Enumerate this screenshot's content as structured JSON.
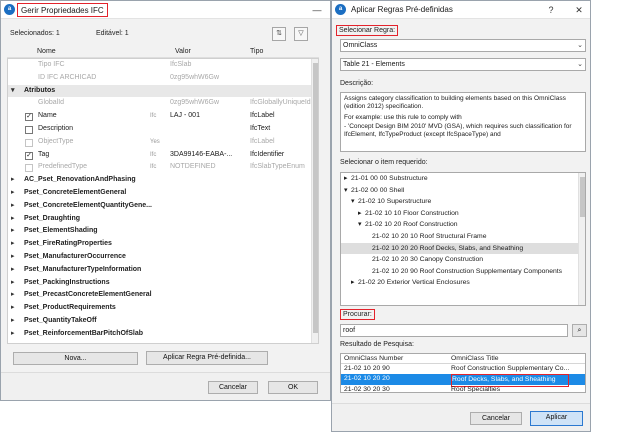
{
  "left": {
    "title": "Gerir Propriedades IFC",
    "min_btn": "—",
    "selected_label": "Selecionados: 1",
    "editable_label": "Editável: 1",
    "tool_icons": [
      "assign-icon",
      "filter-icon"
    ],
    "columns": {
      "name": "Nome",
      "value": "Valor",
      "type": "Tipo"
    },
    "rows": [
      {
        "kind": "dim",
        "indent": 1,
        "name": "Tipo IFC",
        "value": "IfcSlab",
        "type": ""
      },
      {
        "kind": "dim",
        "indent": 1,
        "name": "ID IFC ARCHICAD",
        "value": "0zg95whW6Gw",
        "type": ""
      },
      {
        "kind": "grp",
        "indent": 0,
        "toggle": "▾",
        "name": "Atributos",
        "value": "",
        "type": ""
      },
      {
        "kind": "dim",
        "indent": 1,
        "name": "GlobalId",
        "value": "0zg95whW6Gw",
        "type": "IfcGloballyUniqueId"
      },
      {
        "kind": "cb",
        "checked": "✓",
        "indent": 1,
        "name": "Name",
        "value": "LAJ - 001",
        "type": "IfcLabel",
        "prefix": "Ifc"
      },
      {
        "kind": "cb",
        "checked": "",
        "indent": 1,
        "name": "Description",
        "value": "",
        "type": "IfcText"
      },
      {
        "kind": "dim",
        "cb": true,
        "indent": 1,
        "name": "ObjectType",
        "value": "",
        "type": "IfcLabel",
        "prefix": "Yes"
      },
      {
        "kind": "cb",
        "checked": "✓",
        "indent": 1,
        "name": "Tag",
        "value": "3DA99146-EABA-...",
        "type": "IfcIdentifier",
        "prefix": "Ifc"
      },
      {
        "kind": "dim",
        "cb": true,
        "indent": 1,
        "name": "PredefinedType",
        "value": "NOTDEFINED",
        "type": "IfcSlabTypeEnum",
        "prefix": "Ifc"
      },
      {
        "kind": "pset",
        "toggle": "▸",
        "name": "AC_Pset_RenovationAndPhasing"
      },
      {
        "kind": "pset",
        "toggle": "▸",
        "name": "Pset_ConcreteElementGeneral"
      },
      {
        "kind": "pset",
        "toggle": "▸",
        "name": "Pset_ConcreteElementQuantityGene..."
      },
      {
        "kind": "pset",
        "toggle": "▸",
        "name": "Pset_Draughting"
      },
      {
        "kind": "pset",
        "toggle": "▸",
        "name": "Pset_ElementShading"
      },
      {
        "kind": "pset",
        "toggle": "▸",
        "name": "Pset_FireRatingProperties"
      },
      {
        "kind": "pset",
        "toggle": "▸",
        "name": "Pset_ManufacturerOccurrence"
      },
      {
        "kind": "pset",
        "toggle": "▸",
        "name": "Pset_ManufacturerTypeInformation"
      },
      {
        "kind": "pset",
        "toggle": "▸",
        "name": "Pset_PackingInstructions"
      },
      {
        "kind": "pset",
        "toggle": "▸",
        "name": "Pset_PrecastConcreteElementGeneral"
      },
      {
        "kind": "pset",
        "toggle": "▸",
        "name": "Pset_ProductRequirements"
      },
      {
        "kind": "pset",
        "toggle": "▸",
        "name": "Pset_QuantityTakeOff"
      },
      {
        "kind": "pset",
        "toggle": "▸",
        "name": "Pset_ReinforcementBarPitchOfSlab"
      }
    ],
    "new_btn": "Nova...",
    "apply_rule_btn": "Aplicar Regra Pré-definida...",
    "cancel_btn": "Cancelar",
    "ok_btn": "OK"
  },
  "right": {
    "title": "Aplicar Regras Pré-definidas",
    "help_btn": "?",
    "close_btn": "✕",
    "select_rule_label": "Selecionar Regra:",
    "rule_value": "OmniClass",
    "table_value": "Table 21 - Elements",
    "description_label": "Descrição:",
    "description_paragraphs": [
      "Assigns category classification to building elements based on this OmniClass (edition 2012) specification.",
      "For example: use this rule to comply with\n- 'Concept Design BIM 2010' MVD (GSA), which requires such classification for IfcElement, IfcTypeProduct (except IfcSpaceType) and"
    ],
    "select_item_label": "Selecionar o item requerido:",
    "tree": [
      {
        "indent": 0,
        "toggle": "▸",
        "text": "21-01 00 00 Substructure"
      },
      {
        "indent": 0,
        "toggle": "▾",
        "text": "21-02 00 00 Shell"
      },
      {
        "indent": 1,
        "toggle": "▾",
        "text": "21-02 10 Superstructure"
      },
      {
        "indent": 2,
        "toggle": "▸",
        "text": "21-02 10 10 Floor Construction"
      },
      {
        "indent": 2,
        "toggle": "▾",
        "text": "21-02 10 20 Roof Construction"
      },
      {
        "indent": 3,
        "toggle": "",
        "text": "21-02 10 20 10 Roof Structural Frame"
      },
      {
        "indent": 3,
        "toggle": "",
        "text": "21-02 10 20 20 Roof Decks, Slabs, and Sheathing",
        "selected": true
      },
      {
        "indent": 3,
        "toggle": "",
        "text": "21-02 10 20 30 Canopy Construction"
      },
      {
        "indent": 3,
        "toggle": "",
        "text": "21-02 10 20 90 Roof Construction Supplementary Components"
      },
      {
        "indent": 1,
        "toggle": "▸",
        "text": "21-02 20 Exterior Vertical Enclosures"
      }
    ],
    "search_label": "Procurar:",
    "search_value": "roof",
    "results_label": "Resultado de Pesquisa:",
    "results_header": {
      "number": "OmniClass Number",
      "title": "OmniClass Title"
    },
    "results": [
      {
        "number": "21-02 10 20 90",
        "title": "Roof Construction Supplementary Co..."
      },
      {
        "number": "21-02 10 20 20",
        "title": "Roof Decks, Slabs, and Sheathing",
        "selected": true
      },
      {
        "number": "21-02 30 20 30",
        "title": "Roof Specialties"
      },
      {
        "number": "21-02 10 20 10",
        "title": "Roof Structural Frame"
      },
      {
        "number": "21-02 10 20 30",
        "title": "Canopy Construction"
      }
    ],
    "cancel_btn": "Cancelar",
    "apply_btn": "Aplicar"
  }
}
